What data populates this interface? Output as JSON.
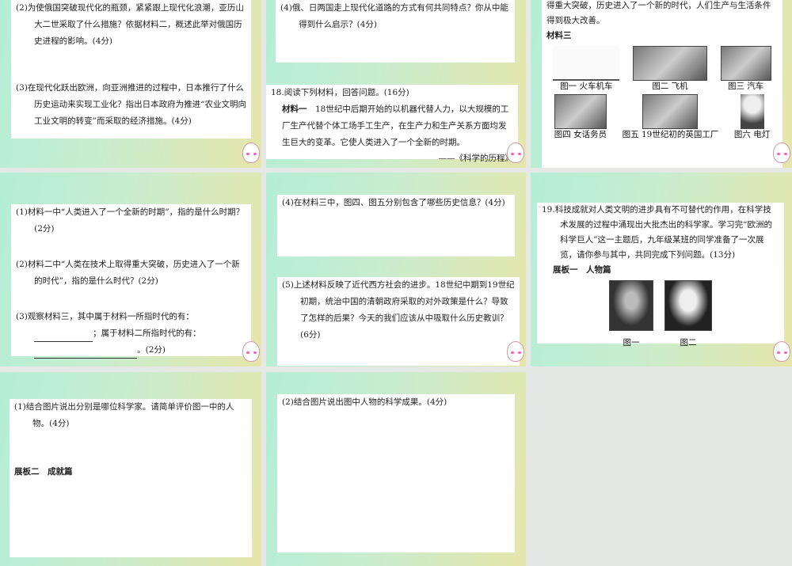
{
  "slides": [
    {
      "q2": "(2)为使俄国突破现代化的瓶颈，紧紧跟上现代化浪潮，亚历山大二世采取了什么措施？依据材料二，概述此举对俄国历史进程的影响。(4分)",
      "q3": "(3)在现代化跃出欧洲，向亚洲推进的过程中，日本推行了什么历史运动来实现工业化？指出日本政府为推进“农业文明向工业文明的转变”而采取的经济措施。(4分)"
    },
    {
      "q4": "(4)俄、日两国走上现代化道路的方式有何共同特点？你从中能得到什么启示？(4分)",
      "q18": "18.阅读下列材料，回答问题。(16分)",
      "m1_label": "材料一",
      "m1": "18世纪中后期开始的以机器代替人力，以大规模的工厂生产代替个体工场手工生产，在生产力和生产关系方面均发生巨大的变革。它使人类进入了一个全新的时期。",
      "source": "——《科学的历程》"
    },
    {
      "m2_tail": "得重大突破，历史进入了一个新的时代，人们生产与生活条件得到极大改善。",
      "m3_label": "材料三",
      "figs": [
        "图一 火车机车",
        "图二 飞机",
        "图三 汽车",
        "图四 女话务员",
        "图五 19世纪初的英国工厂",
        "图六 电灯"
      ]
    },
    {
      "q1": "(1)材料一中“人类进入了一个全新的时期”，指的是什么时期？(2分)",
      "q2": "(2)材料二中“人类在技术上取得重大突破，历史进入了一个新的时代”，指的是什么时代？(2分)",
      "q3a": "(3)观察材料三，其中属于材料一所指时代的有：",
      "q3b": "；属于材料二所指时代的有：",
      "q3c": "。(2分)"
    },
    {
      "q4": "(4)在材料三中，图四、图五分别包含了哪些历史信息？(4分)",
      "q5": "(5)上述材料反映了近代西方社会的进步。18世纪中期到19世纪初期，统治中国的清朝政府采取的对外政策是什么？导致了怎样的后果？今天的我们应该从中吸取什么历史教训？(6分)"
    },
    {
      "q19": "19.科技成就对人类文明的进步具有不可替代的作用，在科学技术发展的过程中涌现出大批杰出的科学家。学习完“欧洲的科学巨人”这一主题后，九年级某班的同学准备了一次展览，请你参与其中，共同完成下列问题。(13分)",
      "board1": "展板一　人物篇",
      "figs": [
        "图一",
        "图二"
      ]
    },
    {
      "q1": "(1)结合图片说出分别是哪位科学家。请简单评价图一中的人物。(4分)",
      "board2": "展板二　成就篇"
    },
    {
      "q2": "(2)结合图片说出图中人物的科学成果。(4分)"
    }
  ]
}
